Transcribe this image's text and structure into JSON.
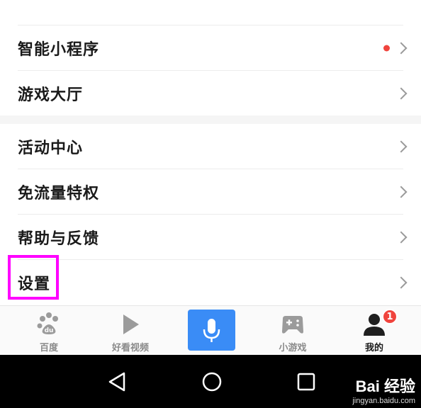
{
  "menu": {
    "items": [
      {
        "label": "智能小程序",
        "has_dot": true
      },
      {
        "label": "游戏大厅",
        "has_dot": false
      },
      {
        "label": "活动中心",
        "has_dot": false
      },
      {
        "label": "免流量特权",
        "has_dot": false
      },
      {
        "label": "帮助与反馈",
        "has_dot": false
      },
      {
        "label": "设置",
        "has_dot": false,
        "highlighted": true
      }
    ]
  },
  "tabbar": {
    "tabs": [
      {
        "label": "百度",
        "icon": "baidu-paw-icon"
      },
      {
        "label": "好看视频",
        "icon": "play-icon"
      },
      {
        "label": "",
        "icon": "microphone-icon"
      },
      {
        "label": "小游戏",
        "icon": "gamepad-icon"
      },
      {
        "label": "我的",
        "icon": "user-icon",
        "active": true
      }
    ],
    "badge_count": "1"
  },
  "system_nav": {
    "icons": [
      "back-icon",
      "home-icon",
      "recents-icon"
    ]
  },
  "watermark": {
    "logo": "Bai 经验",
    "sub": "jingyan.baidu.com"
  },
  "colors": {
    "highlight": "#ff00ff",
    "accent": "#3a8cf6",
    "badge": "#f0443d"
  }
}
